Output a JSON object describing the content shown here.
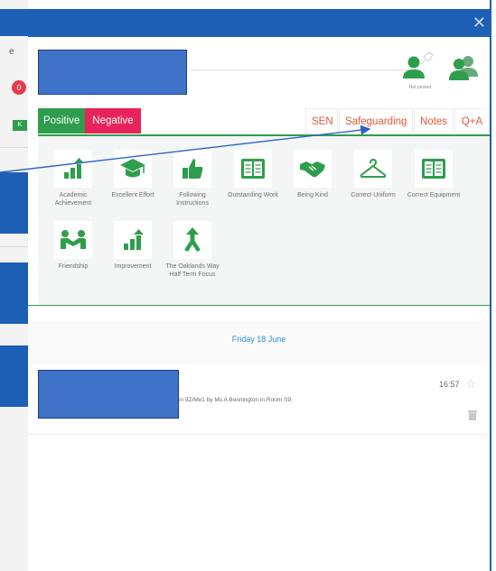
{
  "background": {
    "letter": "e",
    "red_badge": "0",
    "green_badge": "K"
  },
  "panel": {
    "close_icon": "close-icon",
    "pin_label": "Not pinned"
  },
  "tabs": {
    "positive": "Positive",
    "negative": "Negative",
    "sen": "SEN",
    "safeguarding": "Safeguarding",
    "notes": "Notes",
    "qa": "Q+A"
  },
  "behaviours": [
    {
      "label": "Academic Achievement",
      "icon": "bar-chart-up-icon"
    },
    {
      "label": "Excellent Effort",
      "icon": "graduation-cap-icon"
    },
    {
      "label": "Following Instructions",
      "icon": "thumbs-up-icon"
    },
    {
      "label": "Outstanding Work",
      "icon": "open-book-icon"
    },
    {
      "label": "Being Kind",
      "icon": "handshake-icon"
    },
    {
      "label": "Correct Uniform",
      "icon": "hanger-icon"
    },
    {
      "label": "Correct Equipment",
      "icon": "open-book-icon"
    },
    {
      "label": "Friendship",
      "icon": "friends-icon"
    },
    {
      "label": "Improvement",
      "icon": "bar-chart-up-icon"
    },
    {
      "label": "The Oaklands Way Half Term Focus",
      "icon": "split-arrow-icon"
    }
  ],
  "date_heading": "Friday 18 June",
  "event": {
    "text": "in 9Z/Me1 by Ms A Bonnington in Room S9.",
    "time": "16:57"
  },
  "colors": {
    "header_blue": "#1d5fb5",
    "positive_green": "#2e9e4c",
    "negative_pink": "#e8235b",
    "tab_text_orange": "#e05a3a",
    "date_blue": "#2b8fd8"
  }
}
